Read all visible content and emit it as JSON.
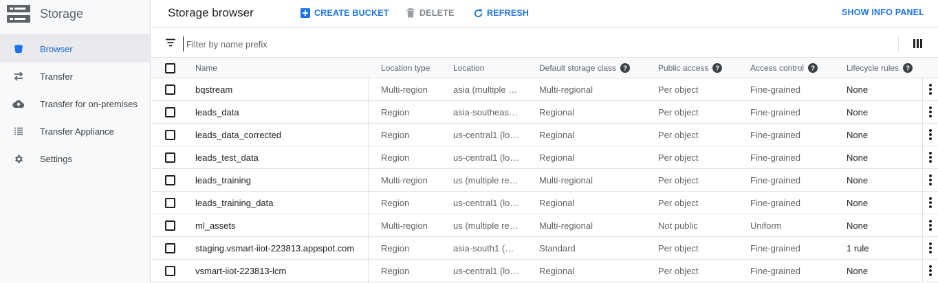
{
  "sidebar": {
    "title": "Storage",
    "items": [
      {
        "label": "Browser",
        "icon": "bucket-icon",
        "active": true
      },
      {
        "label": "Transfer",
        "icon": "transfer-arrows-icon"
      },
      {
        "label": "Transfer for on-premises",
        "icon": "cloud-upload-icon"
      },
      {
        "label": "Transfer Appliance",
        "icon": "list-icon"
      },
      {
        "label": "Settings",
        "icon": "gear-icon"
      }
    ]
  },
  "toolbar": {
    "title": "Storage browser",
    "create_label": "CREATE BUCKET",
    "delete_label": "DELETE",
    "refresh_label": "REFRESH",
    "info_label": "SHOW INFO PANEL"
  },
  "filter": {
    "placeholder": "Filter by name prefix",
    "value": ""
  },
  "table": {
    "headers": {
      "name": "Name",
      "location_type": "Location type",
      "location": "Location",
      "storage_class": "Default storage class",
      "public_access": "Public access",
      "access_control": "Access control",
      "lifecycle": "Lifecycle rules"
    },
    "rows": [
      {
        "name": "bqstream",
        "location_type": "Multi-region",
        "location": "asia (multiple …",
        "storage_class": "Multi-regional",
        "public_access": "Per object",
        "access_control": "Fine-grained",
        "lifecycle": "None"
      },
      {
        "name": "leads_data",
        "location_type": "Region",
        "location": "asia-southeas…",
        "storage_class": "Regional",
        "public_access": "Per object",
        "access_control": "Fine-grained",
        "lifecycle": "None"
      },
      {
        "name": "leads_data_corrected",
        "location_type": "Region",
        "location": "us-central1 (lo…",
        "storage_class": "Regional",
        "public_access": "Per object",
        "access_control": "Fine-grained",
        "lifecycle": "None"
      },
      {
        "name": "leads_test_data",
        "location_type": "Region",
        "location": "us-central1 (lo…",
        "storage_class": "Regional",
        "public_access": "Per object",
        "access_control": "Fine-grained",
        "lifecycle": "None"
      },
      {
        "name": "leads_training",
        "location_type": "Multi-region",
        "location": "us (multiple re…",
        "storage_class": "Multi-regional",
        "public_access": "Per object",
        "access_control": "Fine-grained",
        "lifecycle": "None"
      },
      {
        "name": "leads_training_data",
        "location_type": "Region",
        "location": "us-central1 (lo…",
        "storage_class": "Regional",
        "public_access": "Per object",
        "access_control": "Fine-grained",
        "lifecycle": "None"
      },
      {
        "name": "ml_assets",
        "location_type": "Multi-region",
        "location": "us (multiple re…",
        "storage_class": "Multi-regional",
        "public_access": "Not public",
        "access_control": "Uniform",
        "lifecycle": "None"
      },
      {
        "name": "staging.vsmart-iiot-223813.appspot.com",
        "location_type": "Region",
        "location": "asia-south1 (…",
        "storage_class": "Standard",
        "public_access": "Per object",
        "access_control": "Fine-grained",
        "lifecycle": "1 rule"
      },
      {
        "name": "vsmart-iiot-223813-lcm",
        "location_type": "Region",
        "location": "us-central1 (lo…",
        "storage_class": "Regional",
        "public_access": "Per object",
        "access_control": "Fine-grained",
        "lifecycle": "None"
      }
    ]
  },
  "colors": {
    "accent": "#1a73e8",
    "sidebar_bg": "#f8f9fa",
    "active_bg": "#e8eaed",
    "border": "#e0e0e0",
    "muted_text": "#5f6368"
  }
}
